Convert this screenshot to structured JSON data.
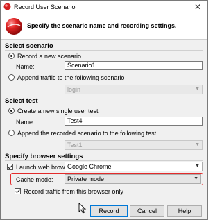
{
  "window": {
    "title": "Record User Scenario",
    "close_glyph": "✕"
  },
  "header": {
    "text": "Specify the scenario name and recording settings."
  },
  "select_scenario": {
    "title": "Select scenario",
    "record_new_label": "Record a new scenario",
    "name_label": "Name:",
    "name_value": "Scenario1",
    "append_label": "Append traffic to the following scenario",
    "append_combo_value": "login"
  },
  "select_test": {
    "title": "Select test",
    "create_new_label": "Create a new single user test",
    "name_label": "Name:",
    "name_value": "Test4",
    "append_label": "Append the recorded scenario to the following test",
    "append_combo_value": "Test1"
  },
  "browser_settings": {
    "title": "Specify browser settings",
    "launch_label": "Launch web browser:",
    "browser_value": "Google Chrome",
    "cache_label": "Cache mode:",
    "cache_value": "Private mode",
    "record_traffic_label": "Record traffic from this browser only"
  },
  "buttons": {
    "record": "Record",
    "cancel": "Cancel",
    "help": "Help"
  },
  "colors": {
    "highlight": "#e32b2b",
    "logo": "#d42020"
  },
  "icons": {
    "app": "app-icon",
    "logo": "logo-icon",
    "dropdown": "chevron-down-icon",
    "cursor": "mouse-cursor-icon"
  }
}
